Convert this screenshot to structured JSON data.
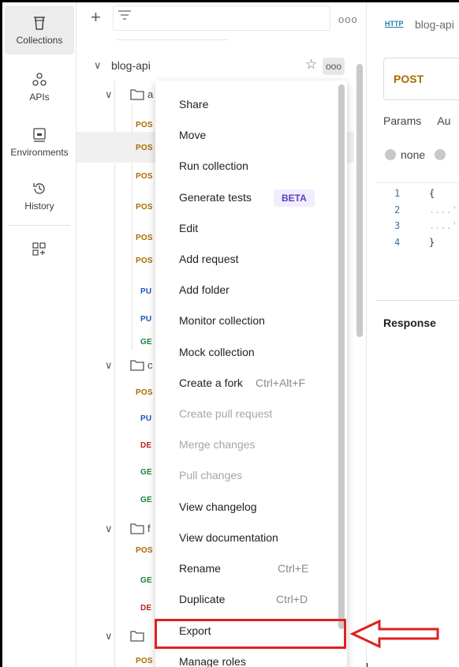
{
  "rail": {
    "items": [
      {
        "label": "Collections",
        "icon": "trash-can-icon"
      },
      {
        "label": "APIs",
        "icon": "apis-icon"
      },
      {
        "label": "Environments",
        "icon": "environments-icon"
      },
      {
        "label": "History",
        "icon": "history-icon"
      }
    ]
  },
  "sidebar": {
    "collection_name": "blog-api",
    "more_label": "ooo",
    "requests": [
      {
        "method": "POS"
      },
      {
        "method": "POS"
      },
      {
        "method": "POS"
      },
      {
        "method": "POS"
      },
      {
        "method": "POS"
      },
      {
        "method": "POS"
      },
      {
        "method": "PU"
      },
      {
        "method": "PU"
      },
      {
        "method": "GE"
      },
      {
        "method": "POS"
      },
      {
        "method": "PU"
      },
      {
        "method": "DE"
      },
      {
        "method": "GE"
      },
      {
        "method": "GE"
      },
      {
        "method": "POS"
      },
      {
        "method": "GE"
      },
      {
        "method": "DE"
      },
      {
        "method": "POS"
      }
    ],
    "folders": [
      {
        "letter": "a"
      },
      {
        "letter": "c"
      },
      {
        "letter": "f"
      },
      {
        "letter": ""
      }
    ]
  },
  "main": {
    "tab_title": "blog-api",
    "http_label": "HTTP",
    "method": "POST",
    "req_tabs": [
      "Params",
      "Au"
    ],
    "body_opts": [
      "none"
    ],
    "line_numbers": [
      "1",
      "2",
      "3",
      "4"
    ],
    "code": [
      "{",
      "....'",
      "....'",
      "}"
    ],
    "response_label": "Response"
  },
  "menu": {
    "items": [
      {
        "label": "Share"
      },
      {
        "label": "Move"
      },
      {
        "label": "Run collection"
      },
      {
        "label": "Generate tests",
        "badge": "BETA"
      },
      {
        "label": "Edit"
      },
      {
        "label": "Add request"
      },
      {
        "label": "Add folder"
      },
      {
        "label": "Monitor collection"
      },
      {
        "label": "Mock collection"
      },
      {
        "label": "Create a fork",
        "shortcut": "Ctrl+Alt+F"
      },
      {
        "label": "Create pull request",
        "disabled": true
      },
      {
        "label": "Merge changes",
        "disabled": true
      },
      {
        "label": "Pull changes",
        "disabled": true
      },
      {
        "label": "View changelog"
      },
      {
        "label": "View documentation"
      },
      {
        "label": "Rename",
        "shortcut": "Ctrl+E"
      },
      {
        "label": "Duplicate",
        "shortcut": "Ctrl+D"
      },
      {
        "label": "Export"
      },
      {
        "label": "Manage roles"
      }
    ]
  },
  "colors": {
    "post": "#a86b00",
    "put": "#1b56b8",
    "get": "#1d7d3c",
    "delete": "#b3261e",
    "highlight": "#e02020"
  }
}
